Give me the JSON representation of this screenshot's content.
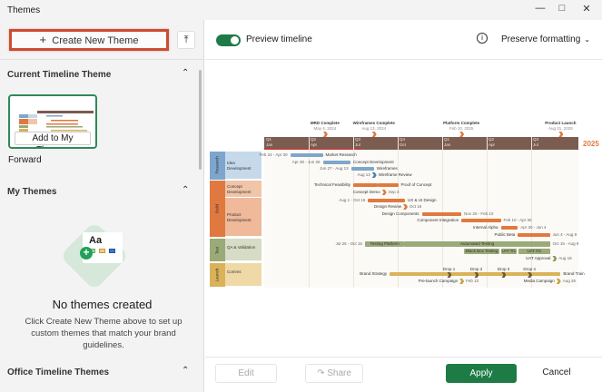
{
  "window": {
    "title": "Themes",
    "minimize_icon": "minimize-icon",
    "maximize_icon": "maximize-icon",
    "close_icon": "close-icon"
  },
  "left": {
    "create_label": "Create New Theme",
    "create_icon": "plus-icon",
    "top_icon": "scroll-to-top-icon",
    "current_section": "Current Timeline Theme",
    "add_to_my_themes": "Add to My Themes",
    "current_theme_name": "Forward",
    "my_themes_section": "My Themes",
    "empty_title": "No themes created",
    "empty_text": "Click Create New Theme above to set up custom themes that match your brand guidelines.",
    "empty_illustration_text": "Aa",
    "office_section": "Office Timeline Themes"
  },
  "toolbar": {
    "preview_label": "Preview timeline",
    "preview_on": true,
    "info_icon": "info-icon",
    "format_select": "Preserve formatting"
  },
  "footer": {
    "edit": "Edit",
    "share": "Share",
    "apply": "Apply",
    "cancel": "Cancel"
  },
  "colors": {
    "accent_green": "#1e7b45",
    "highlight_red": "#d04a2f",
    "header_brown": "#7a5c51",
    "orange": "#e0793f",
    "blue": "#7ea6cd",
    "olive": "#9aaa78",
    "gold": "#d9b25a"
  },
  "timeline": {
    "year_label": "2025",
    "quarters": [
      {
        "q": "Q1",
        "m": "Jan"
      },
      {
        "q": "Q2",
        "m": "Apr"
      },
      {
        "q": "Q3",
        "m": "Jul"
      },
      {
        "q": "Q4",
        "m": "Oct"
      },
      {
        "q": "Q1",
        "m": "Jan"
      },
      {
        "q": "Q2",
        "m": "Apr"
      },
      {
        "q": "Q3",
        "m": "Jul"
      }
    ],
    "top_milestones": [
      {
        "name": "MRD Complete",
        "date": "2024-05-04",
        "date_label": "May 4, 2024"
      },
      {
        "name": "Wireframes Complete",
        "date": "2024-08-13",
        "date_label": "Aug 13, 2024"
      },
      {
        "name": "Platform Complete",
        "date": "2025-02-10",
        "date_label": "Feb 10, 2025"
      },
      {
        "name": "Product Launch",
        "date": "2025-08-31",
        "date_label": "Aug 31, 2025"
      }
    ],
    "swimlanes": [
      {
        "name": "Research",
        "sub": "Idea Development",
        "color": "#7ea6cd",
        "light": "#c6d9ea"
      },
      {
        "name": "Build",
        "sub": "Concept Development",
        "color": "#e0793f",
        "light": "#f1c5a8"
      },
      {
        "name": "Build",
        "sub": "Product Development",
        "color": "#e0793f",
        "light": "#efb99a"
      },
      {
        "name": "Test",
        "sub": "QA & Validation",
        "color": "#9aaa78",
        "light": "#d6dcc5"
      },
      {
        "name": "Launch",
        "sub": "Comms",
        "color": "#d9b25a",
        "light": "#eed9a7"
      }
    ],
    "tasks": [
      {
        "name": "Market Research",
        "start": "2024-02-24",
        "end": "2024-04-30",
        "date_label": "Feb 24 - Apr 30",
        "color": "#7ea6cd"
      },
      {
        "name": "Concept Development",
        "start": "2024-04-30",
        "end": "2024-06-26",
        "date_label": "Apr 30 - Jun 26",
        "color": "#7ea6cd"
      },
      {
        "name": "Wireframes",
        "start": "2024-06-27",
        "end": "2024-08-13",
        "date_label": "Jun 27 - Aug 13",
        "color": "#7ea6cd"
      },
      {
        "name": "Wireframe Review",
        "start": "2024-08-13",
        "date_label": "Aug 13",
        "color": "#4f7fb5",
        "milestone": true
      },
      {
        "name": "Technical Feasibility",
        "start": "2024-07-01",
        "end": "2024-08-20",
        "date_label": "",
        "color": "#e0793f",
        "label_left": true
      },
      {
        "name": "Proof of Concept",
        "start": "2024-08-21",
        "end": "2024-10-02",
        "date_label": "",
        "color": "#e0793f"
      },
      {
        "name": "Concept Demo",
        "start": "2024-09-03",
        "date_label": "Sep 3",
        "color": "#e0793f",
        "milestone": true,
        "label_left": true
      },
      {
        "name": "UX & UI Design",
        "start": "2024-08-01",
        "end": "2024-10-16",
        "date_label": "Aug 1 - Oct 16",
        "color": "#e0793f"
      },
      {
        "name": "Design Review",
        "start": "2024-10-16",
        "date_label": "Oct 16",
        "color": "#e0793f",
        "milestone": true,
        "label_left": true
      },
      {
        "name": "Design Components",
        "start": "2024-11-20",
        "end": "2025-02-10",
        "date_label": "Nov 20 - Feb 10",
        "color": "#e0793f",
        "label_left": true
      },
      {
        "name": "Component Integration",
        "start": "2025-02-10",
        "end": "2025-04-30",
        "date_label": "Feb 10 - Apr 30",
        "color": "#e0793f",
        "label_left": true
      },
      {
        "name": "Internal Alpha",
        "start": "2025-04-30",
        "end": "2025-06-04",
        "date_label": "Apr 30 - Jun 4",
        "color": "#e0793f",
        "label_left": true
      },
      {
        "name": "Public Beta",
        "start": "2025-06-04",
        "end": "2025-08-09",
        "date_label": "Jun 4 - Aug 9",
        "color": "#e0793f",
        "label_left": true
      },
      {
        "name": "Testing Platform",
        "start": "2024-07-25",
        "end": "2024-10-15",
        "date_label": "Jul 25 - Oct 15",
        "color": "#9aaa78",
        "inside": true
      },
      {
        "name": "Automated Testing",
        "start": "2024-10-15",
        "end": "2025-08-09",
        "date_label": "Oct 15 - Aug 9",
        "color": "#9aaa78",
        "inside": true
      },
      {
        "name": "Black Box Testing",
        "start": "2025-02-15",
        "end": "2025-04-28",
        "date_label": "",
        "color": "#9aaa78",
        "inside": true
      },
      {
        "name": "UAT R1",
        "start": "2025-04-30",
        "end": "2025-06-02",
        "date_label": "",
        "color": "#9aaa78",
        "inside": true
      },
      {
        "name": "UAT R2",
        "start": "2025-06-05",
        "end": "2025-08-09",
        "date_label": "",
        "color": "#9aaa78",
        "inside": true
      },
      {
        "name": "UAT Approval",
        "start": "2025-08-18",
        "date_label": "Aug 18",
        "color": "#8a9a63",
        "milestone": true,
        "label_left": true
      },
      {
        "name": "Brand Strategy",
        "start": "2024-09-15",
        "end": "2025-08-31",
        "date_label": "",
        "color": "#d9b25a",
        "label_left": true,
        "right_label": "Brand Train"
      },
      {
        "name": "Drop 1",
        "start": "2025-01-15",
        "date_label": "",
        "color": "#6b5a33",
        "milestone": true,
        "label_above": true
      },
      {
        "name": "Drop 2",
        "start": "2025-03-10",
        "date_label": "",
        "color": "#6b5a33",
        "milestone": true,
        "label_above": true
      },
      {
        "name": "Drop 3",
        "start": "2025-05-05",
        "date_label": "",
        "color": "#6b5a33",
        "milestone": true,
        "label_above": true
      },
      {
        "name": "Drop 4",
        "start": "2025-06-28",
        "date_label": "",
        "color": "#6b5a33",
        "milestone": true,
        "label_above": true
      },
      {
        "name": "Pre-launch Campaign",
        "start": "2025-02-10",
        "date_label": "Feb 10",
        "color": "#c9a23f",
        "milestone": true,
        "label_left": true
      },
      {
        "name": "Media Campaign",
        "start": "2025-08-26",
        "date_label": "Aug 26",
        "color": "#c9a23f",
        "milestone": true,
        "label_left": true
      }
    ]
  }
}
